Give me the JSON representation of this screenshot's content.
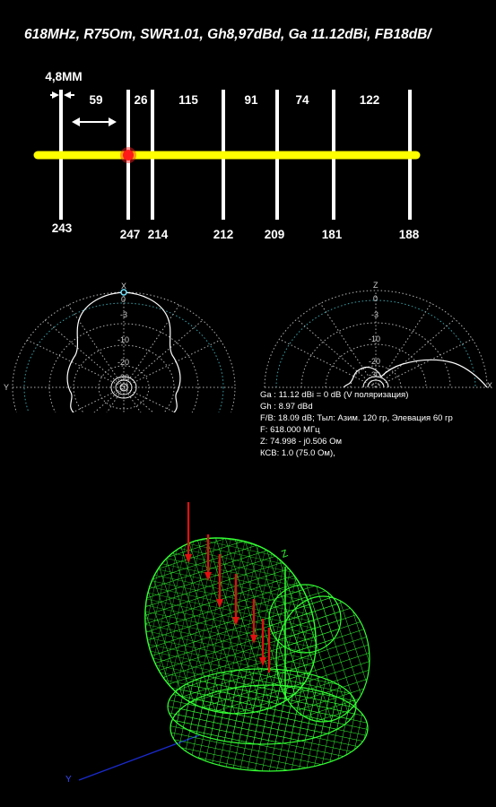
{
  "title": "618MHz, R75Om, SWR1.01, Gh8,97dBd, Ga 11.12dBi, FB18dB/",
  "layout": {
    "element_gap_label": "4,8MM",
    "spacings": [
      "59",
      "26",
      "115",
      "91",
      "74",
      "122"
    ],
    "element_lengths": [
      "243",
      "247",
      "214",
      "212",
      "209",
      "181",
      "188"
    ]
  },
  "polar_horizontal": {
    "top_axis_label": "X",
    "side_axis_label": "Y",
    "ring_labels": [
      "0",
      "-3",
      "-10",
      "-20",
      "-30"
    ]
  },
  "polar_vertical": {
    "top_axis_label": "Z",
    "side_axis_label": "X",
    "ring_labels": [
      "0",
      "-3",
      "-10",
      "-20",
      "-30"
    ]
  },
  "info_lines": [
    "Ga : 11.12 dBi = 0 dB  (V поляризация)",
    "Gh : 8.97 dBd",
    "F/B: 18.09 dB; Тыл: Азим. 120 гр, Элевация 60 гр",
    "F: 618.000 МГц",
    "Z: 74.998 - j0.506 Ом",
    "КСВ: 1.0 (75.0 Ом),"
  ],
  "plot3d": {
    "z_axis_label": "Z",
    "y_axis_label": "Y"
  },
  "colors": {
    "boom": "#ffff00",
    "feedpoint": "#ff1a1a",
    "polar_grid": "#b0b0b0",
    "polar_ring_accent": "#3aa0a8",
    "pattern": "#ffffff",
    "mesh": "#33ff33",
    "current_arrows": "#e01010",
    "y_axis_line": "#1a2bd0"
  }
}
